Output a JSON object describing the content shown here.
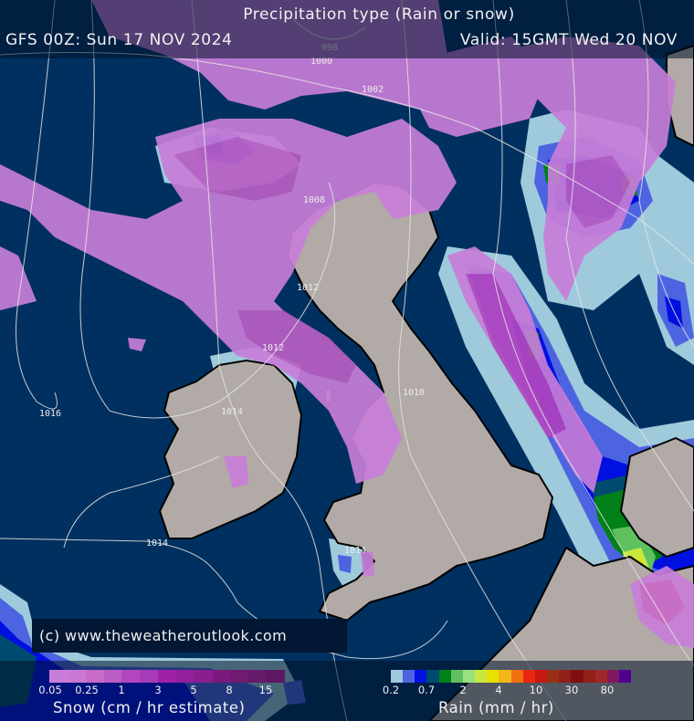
{
  "header": {
    "title": "Precipitation type (Rain or snow)",
    "model_run": "GFS 00Z: Sun 17 NOV 2024",
    "valid_time": "Valid: 15GMT Wed 20 NOV"
  },
  "copyright": "(c) www.theweatheroutlook.com",
  "colors": {
    "sea": "#00305f",
    "land": "#b1aaa6",
    "coastline": "#000000",
    "isobar": "#e6e6e6"
  },
  "isobars": [
    {
      "label": "998"
    },
    {
      "label": "1000"
    },
    {
      "label": "1002"
    },
    {
      "label": "1008"
    },
    {
      "label": "1012"
    },
    {
      "label": "1012"
    },
    {
      "label": "1014"
    },
    {
      "label": "1010"
    },
    {
      "label": "1016"
    },
    {
      "label": "1014"
    },
    {
      "label": "1014"
    }
  ],
  "legend": {
    "snow": {
      "title": "Snow (cm / hr estimate)",
      "ticks": [
        "0.05",
        "0.25",
        "1",
        "3",
        "5",
        "8",
        "15"
      ],
      "colors": [
        "#c87ed8",
        "#c978d6",
        "#c86bc8",
        "#b95fc4",
        "#b247c0",
        "#a83cb8",
        "#a020a8",
        "#931f9d",
        "#8a1e8e",
        "#7a1a7c",
        "#711a72",
        "#651a6a",
        "#5e1863"
      ]
    },
    "rain": {
      "title": "Rain (mm / hr)",
      "ticks": [
        "0.2",
        "0.7",
        "2",
        "4",
        "10",
        "30",
        "80"
      ],
      "colors": [
        "#9ecadc",
        "#4d64e0",
        "#0010e0",
        "#004c70",
        "#008018",
        "#60c060",
        "#98e080",
        "#c8e840",
        "#e8e000",
        "#f0b818",
        "#f07010",
        "#e82810",
        "#c81810",
        "#983018",
        "#902018",
        "#801010",
        "#902018",
        "#a02828",
        "#801860",
        "#500090"
      ]
    }
  }
}
